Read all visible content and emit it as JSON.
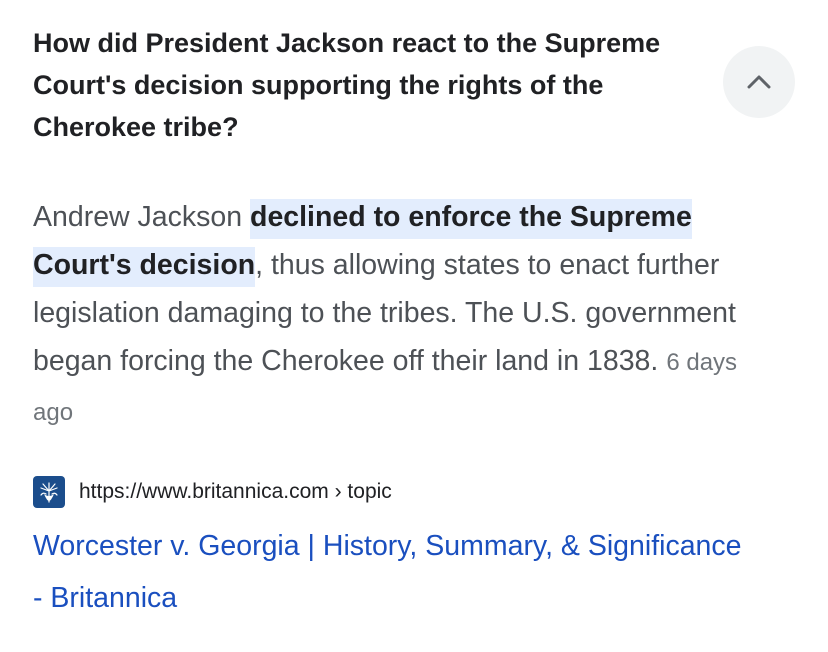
{
  "question": {
    "text": "How did President Jackson react to the Supreme Court's decision supporting the rights of the Cherokee tribe?"
  },
  "collapse_button": {
    "icon": "chevron-up-icon"
  },
  "answer": {
    "prefix": "Andrew Jackson ",
    "highlight": "declined to enforce the Supreme Court's decision",
    "rest": ", thus allowing states to enact further legislation damaging to the tribes. The U.S. government began forcing the Cherokee off their land in 1838.",
    "date": "6 days ago"
  },
  "source": {
    "icon": "britannica-thistle-icon",
    "url": "https://www.britannica.com › topic"
  },
  "result": {
    "title": "Worcester v. Georgia | History, Summary, & Significance - Britannica"
  },
  "colors": {
    "highlight_bg": "#e3edfd",
    "link": "#1a4fbf",
    "favicon_bg": "#1b4d8c"
  }
}
